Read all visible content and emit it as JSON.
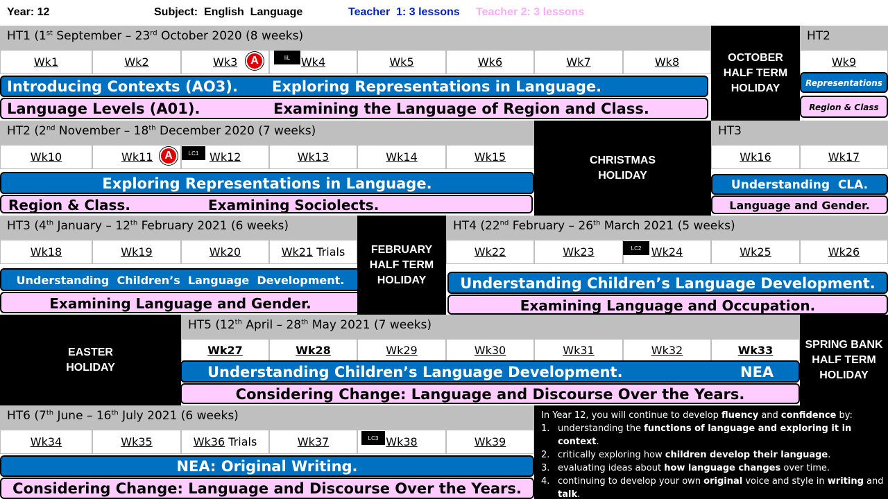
{
  "header": {
    "year_label": "Year:  12",
    "subject_label": "Subject:  English  Language",
    "teacher1": "Teacher  1: 3 lessons",
    "teacher2": "Teacher 2: 3 lessons",
    "colors": {
      "teacher1": "#0020c0",
      "teacher2": "#ffaaff",
      "blue_bar": "#0070c0",
      "pink_bar": "#ffccff",
      "grey_bar": "#bfbfbf"
    }
  },
  "ht1": {
    "title_a": "HT1 (1",
    "sup_a": "st",
    "title_b": " September – 23",
    "sup_b": "rd",
    "title_c": " October 2020 (8 weeks)",
    "weeks": [
      "Wk1",
      "Wk2",
      "Wk3",
      "Wk4",
      "Wk5",
      "Wk6",
      "Wk7",
      "Wk8"
    ],
    "blue_a": "Introducing Contexts (AO3).",
    "blue_b": "Exploring Representations in Language.",
    "pink_a": "Language Levels (A01).",
    "pink_b": "Examining the Language of Region and Class."
  },
  "ht2_side": {
    "title": "HT2",
    "week": "Wk9",
    "blue": "Representations",
    "pink": "Region & Class"
  },
  "markers": {
    "assessment": "A",
    "iil": "IiL",
    "lc1": "LC1",
    "lc2": "LC2",
    "lc3": "LC3"
  },
  "holidays": {
    "october": "OCTOBER\nHALF TERM\nHOLIDAY",
    "christmas": "CHRISTMAS\nHOLIDAY",
    "february": "FEBRUARY\nHALF TERM\nHOLIDAY",
    "easter": "EASTER\nHOLIDAY",
    "spring": "SPRING BANK\nHALF TERM\nHOLIDAY"
  },
  "ht2": {
    "title_a": "HT2 (2",
    "sup_a": "nd",
    "title_b": " November – 18",
    "sup_b": "th",
    "title_c": " December 2020 (7 weeks)",
    "weeks": [
      "Wk10",
      "Wk11",
      "Wk12",
      "Wk13",
      "Wk14",
      "Wk15"
    ],
    "blue": "Exploring Representations in Language.",
    "pink_a": "Region & Class.",
    "pink_b": "Examining Sociolects."
  },
  "ht3_side": {
    "title": "HT3",
    "weeks": [
      "Wk16",
      "Wk17"
    ],
    "blue": "Understanding  CLA.",
    "pink": "Language and Gender."
  },
  "ht3": {
    "title_a": "HT3 (4",
    "sup_a": "th",
    "title_b": " January – 12",
    "sup_b": "th",
    "title_c": " February 2021 (6 weeks)",
    "weeks": [
      "Wk18",
      "Wk19",
      "Wk20",
      "Wk21"
    ],
    "trials": "Trials",
    "blue": "Understanding  Children’s  Language  Development.",
    "pink": "Examining Language and Gender."
  },
  "ht4": {
    "title_a": "HT4 (22",
    "sup_a": "nd",
    "title_b": " February – 26",
    "sup_b": "th",
    "title_c": " March 2021 (5 weeks)",
    "weeks": [
      "Wk22",
      "Wk23",
      "Wk24",
      "Wk25",
      "Wk26"
    ],
    "blue": "Understanding Children’s Language Development.",
    "pink": "Examining Language and Occupation."
  },
  "ht5": {
    "title_a": "HT5 (12",
    "sup_a": "th",
    "title_b": " April – 28",
    "sup_b": "th",
    "title_c": " May 2021 (7 weeks)",
    "weeks": [
      "Wk27",
      "Wk28",
      "Wk29",
      "Wk30",
      "Wk31",
      "Wk32",
      "Wk33"
    ],
    "blue_a": "Understanding Children’s Language Development.",
    "blue_b": "NEA",
    "pink": "Considering Change: Language and Discourse Over the Years."
  },
  "ht6": {
    "title_a": "HT6 (7",
    "sup_a": "th",
    "title_b": " June – 16",
    "sup_b": "th",
    "title_c": " July 2021 (6 weeks)",
    "weeks": [
      "Wk34",
      "Wk35",
      "Wk36",
      "Wk37",
      "Wk38",
      "Wk39"
    ],
    "trials": "Trials",
    "blue": "NEA: Original Writing.",
    "pink": "Considering Change: Language and Discourse Over the Years."
  },
  "info": {
    "intro_a": "In Year 12, you will continue to develop ",
    "intro_b": "fluency",
    "intro_c": " and ",
    "intro_d": "confidence",
    "intro_e": " by:",
    "items": [
      {
        "n": "1.",
        "a": "understanding the ",
        "b": "functions of language and exploring it in context",
        "c": "."
      },
      {
        "n": "2.",
        "a": "critically exploring how ",
        "b": "children develop their language",
        "c": "."
      },
      {
        "n": "3.",
        "a": "evaluating ideas about ",
        "b": "how language changes",
        "c": " over time."
      },
      {
        "n": "4.",
        "a": "continuing to develop your own ",
        "b": "original",
        "c": " voice and style in ",
        "d": "writing",
        "e": " and ",
        "f": "talk",
        "g": "."
      }
    ]
  }
}
